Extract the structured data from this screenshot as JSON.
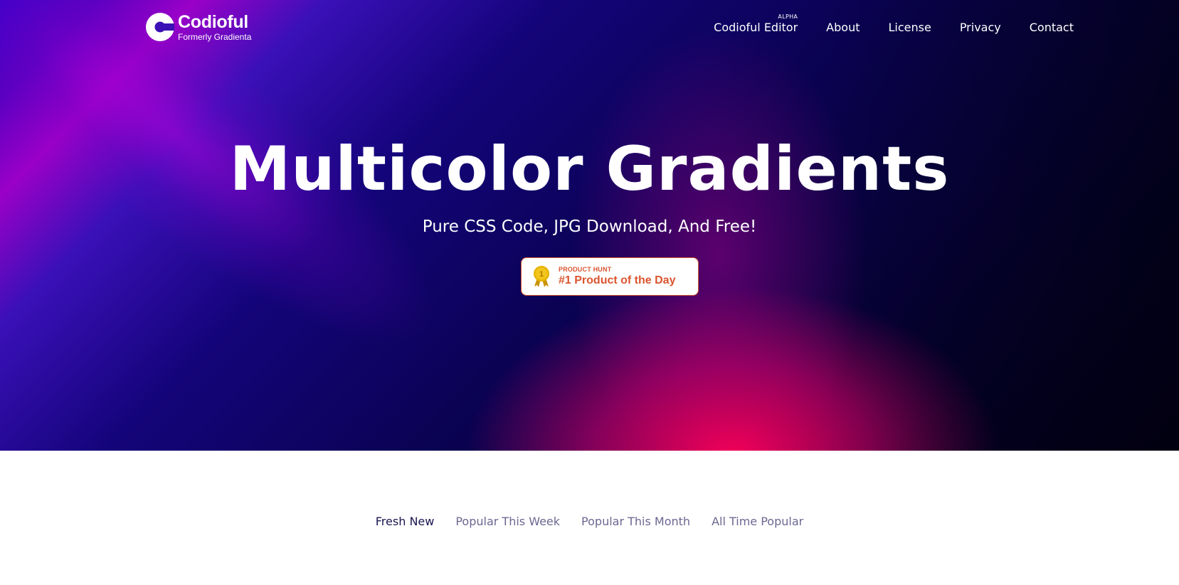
{
  "brand": {
    "name": "Codioful",
    "tagline": "Formerly Gradienta"
  },
  "nav": {
    "items": [
      {
        "label": "Codioful Editor",
        "badge": "ALPHA"
      },
      {
        "label": "About"
      },
      {
        "label": "License"
      },
      {
        "label": "Privacy"
      },
      {
        "label": "Contact"
      }
    ]
  },
  "hero": {
    "title": "Multicolor Gradients",
    "subtitle": "Pure CSS Code, JPG Download, And Free!"
  },
  "product_hunt": {
    "top_label": "PRODUCT HUNT",
    "main_label": "#1 Product of the Day",
    "medal_number": "1",
    "color": "#da552f"
  },
  "tabs": [
    {
      "label": "Fresh New",
      "active": true
    },
    {
      "label": "Popular This Week",
      "active": false
    },
    {
      "label": "Popular This Month",
      "active": false
    },
    {
      "label": "All Time Popular",
      "active": false
    }
  ]
}
